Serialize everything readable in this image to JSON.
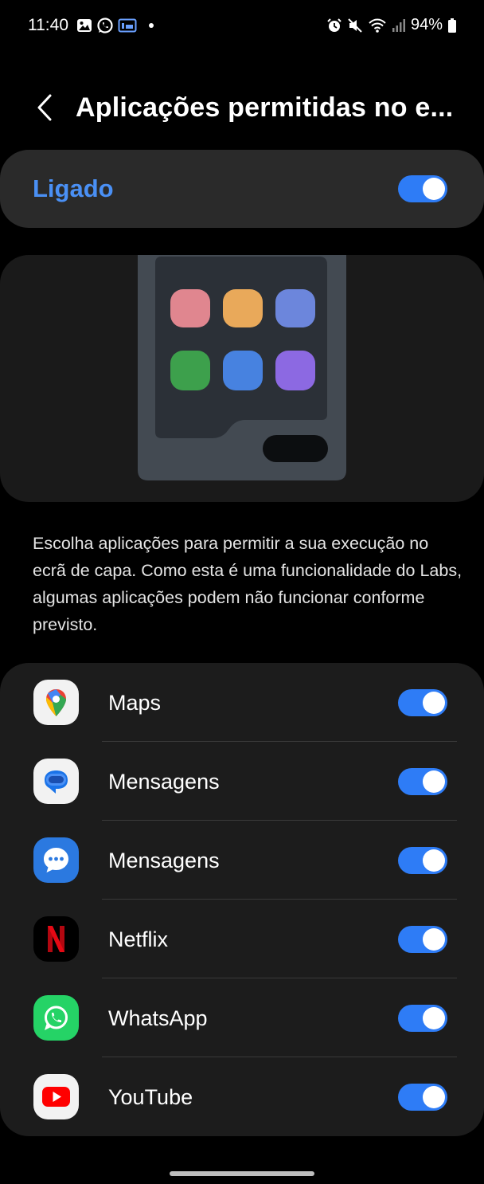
{
  "status_bar": {
    "time": "11:40",
    "battery": "94%",
    "left_icons": [
      "gallery-icon",
      "whatsapp-icon",
      "labs-icon",
      "dot-icon"
    ],
    "right_icons": [
      "alarm-icon",
      "mute-icon",
      "wifi-icon",
      "signal-icon",
      "battery-icon"
    ]
  },
  "header": {
    "title": "Aplicações permitidas no e...",
    "back_icon": "chevron-left-icon"
  },
  "master": {
    "label": "Ligado",
    "enabled": true
  },
  "illustration": {
    "icon_colors": [
      "#e0868f",
      "#e9a95a",
      "#6c86dc",
      "#3da04c",
      "#4782e0",
      "#8c69e2"
    ],
    "frame_color": "#434a52",
    "screen_color": "#2b3037"
  },
  "description": "Escolha aplicações para permitir a sua execução no ecrã de capa. Como esta é uma funcionalidade do Labs, algumas aplicações podem não funcionar conforme previsto.",
  "apps": [
    {
      "name": "Maps",
      "icon": "google-maps-icon",
      "enabled": true
    },
    {
      "name": "Mensagens",
      "icon": "google-messages-icon",
      "enabled": true
    },
    {
      "name": "Mensagens",
      "icon": "samsung-messages-icon",
      "enabled": true
    },
    {
      "name": "Netflix",
      "icon": "netflix-icon",
      "enabled": true
    },
    {
      "name": "WhatsApp",
      "icon": "whatsapp-icon",
      "enabled": true
    },
    {
      "name": "YouTube",
      "icon": "youtube-icon",
      "enabled": true
    }
  ],
  "colors": {
    "accent": "#2e7cf6",
    "label_accent": "#4a90f5",
    "card": "#1c1c1c"
  }
}
